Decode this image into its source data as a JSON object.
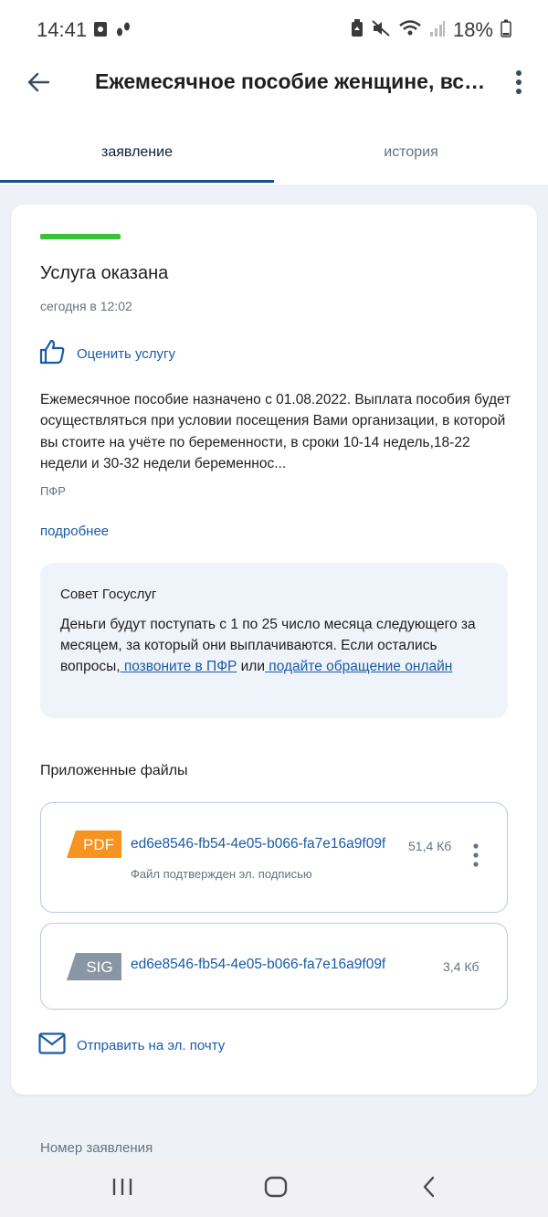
{
  "status_bar": {
    "time": "14:41",
    "battery": "18%",
    "left_icons": [
      "screen-record-icon",
      "steps-icon"
    ],
    "right_icons": [
      "battery-saver-icon",
      "mute-icon",
      "wifi-icon",
      "signal-icon",
      "battery-icon"
    ]
  },
  "appbar": {
    "title": "Ежемесячное пособие женщине, вставшей на учет в медицинской организации в ранние сроки беременности"
  },
  "tabs": [
    {
      "label": "заявление",
      "active": true
    },
    {
      "label": "история",
      "active": false
    }
  ],
  "card": {
    "status": "Услуга оказана",
    "status_color": "#3cc13b",
    "time": "сегодня в 12:02",
    "rate_label": "Оценить услугу",
    "description": "Ежемесячное пособие назначено с 01.08.2022. Выплата пособия будет осуществляться при условии посещения Вами организации, в которой вы стоите на учёте по беременности, в сроки 10-14 недель,18-22 недели и 30-32 недели беременнос...",
    "org": "ПФР",
    "more_label": "подробнее",
    "tip": {
      "title": "Совет Госуслуг",
      "text_before": "Деньги будут поступать с 1 по 25 число месяца следующего за месяцем, за который они выплачиваются. Если остались вопросы,",
      "link1": " позвоните в ПФР",
      "text_middle": " или",
      "link2": " подайте обращение онлайн"
    },
    "files_title": "Приложенные файлы",
    "files": [
      {
        "type": "PDF",
        "name": "ed6e8546-fb54-4e05-b066-fa7e16a9f09f",
        "size": "51,4 Кб",
        "note": "Файл подтвержден эл. подписью",
        "color": "#f7931e"
      },
      {
        "type": "SIG",
        "name": "ed6e8546-fb54-4e05-b066-fa7e16a9f09f",
        "size": "3,4 Кб",
        "color": "#8a96a3"
      }
    ],
    "send_email_label": "Отправить на эл. почту"
  },
  "application_number_label": "Номер заявления",
  "accent_color": "#1a5ba8"
}
